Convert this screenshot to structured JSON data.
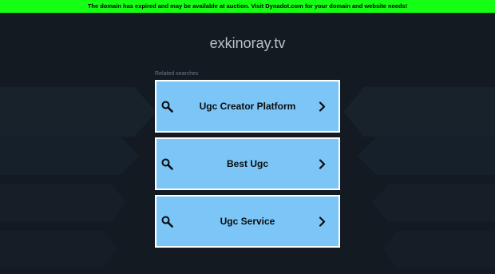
{
  "banner": {
    "text": "The domain has expired and may be available at auction. Visit Dynadot.com for your domain and website needs!"
  },
  "domain": {
    "title": "exkinoray.tv"
  },
  "related": {
    "label": "Related searches",
    "items": [
      {
        "label": "Ugc Creator Platform"
      },
      {
        "label": "Best Ugc"
      },
      {
        "label": "Ugc Service"
      }
    ]
  },
  "colors": {
    "background": "#141a22",
    "banner": "#14ff14",
    "card": "#7cc6f7",
    "card_border": "#ffffff"
  },
  "icons": {
    "left": "search-icon",
    "right": "chevron-right-icon"
  }
}
